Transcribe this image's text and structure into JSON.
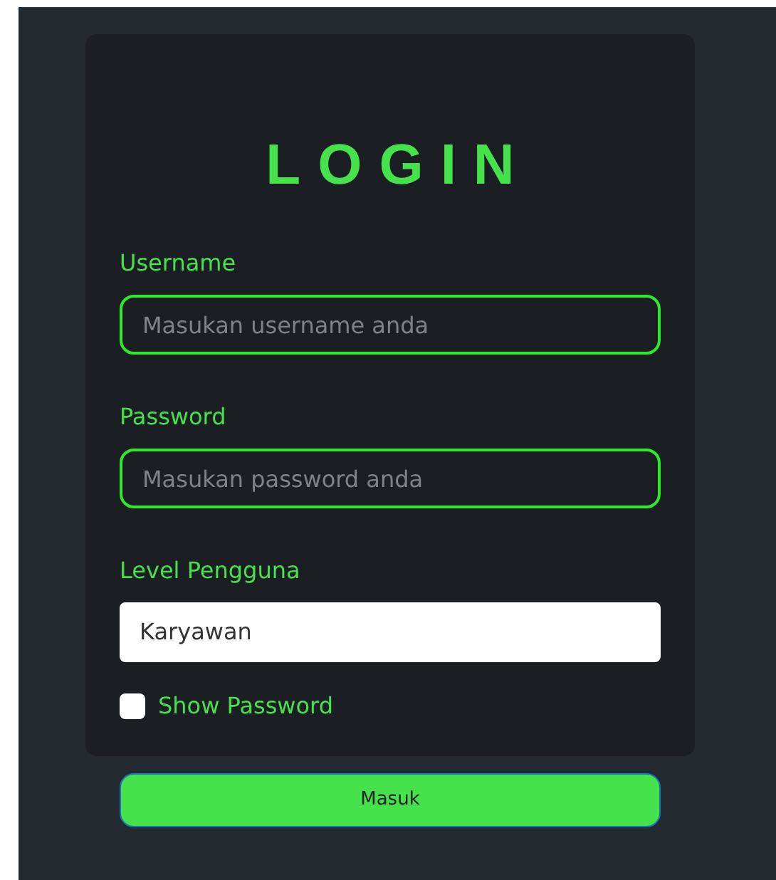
{
  "title": "LOGIN",
  "fields": [
    {
      "kind": "input",
      "label": "Username",
      "placeholder": "Masukan username anda"
    },
    {
      "kind": "input",
      "label": "Password",
      "placeholder": "Masukan password anda"
    },
    {
      "kind": "select",
      "label": "Level Pengguna",
      "value": "Karyawan"
    }
  ],
  "show_password": {
    "label": "Show Password",
    "checked": false
  },
  "submit": "Masuk"
}
